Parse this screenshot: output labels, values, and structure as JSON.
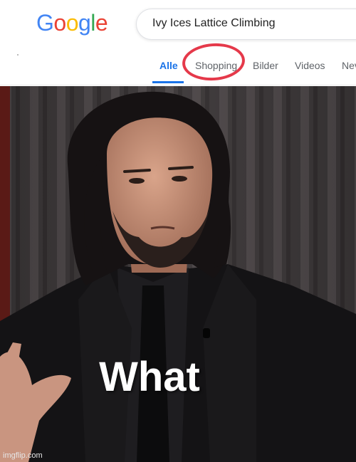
{
  "search": {
    "logo_text": "Google",
    "logo_letters": [
      {
        "char": "G",
        "color": "#4285F4"
      },
      {
        "char": "o",
        "color": "#EA4335"
      },
      {
        "char": "o",
        "color": "#FBBC05"
      },
      {
        "char": "g",
        "color": "#4285F4"
      },
      {
        "char": "l",
        "color": "#34A853"
      },
      {
        "char": "e",
        "color": "#EA4335"
      }
    ],
    "query": "Ivy Ices Lattice Climbing",
    "tabs": [
      {
        "label": "Alle",
        "active": true
      },
      {
        "label": "Shopping",
        "active": false,
        "circled": true
      },
      {
        "label": "Bilder",
        "active": false
      },
      {
        "label": "Videos",
        "active": false
      },
      {
        "label": "Nev",
        "active": false
      }
    ],
    "accent_color": "#1a73e8",
    "annotation_color": "#e5394a"
  },
  "meme": {
    "caption": "What",
    "watermark": "imgflip.com"
  }
}
